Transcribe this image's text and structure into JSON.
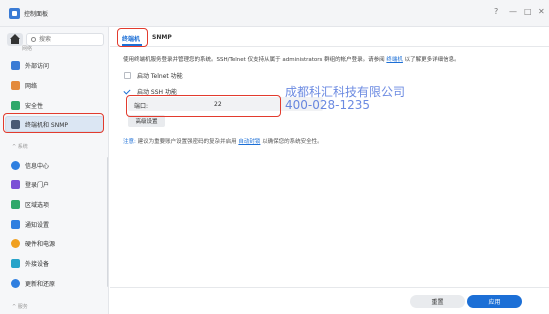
{
  "window": {
    "title": "控制面板",
    "controls": {
      "help": "?",
      "minimize": "—",
      "maximize": "□",
      "close": "✕"
    }
  },
  "sidebar": {
    "search_placeholder": "搜索",
    "top_cut_label": "网络",
    "items_top": [
      {
        "label": "外部访问",
        "icon": "external-access-icon",
        "color": "#3a7bd5"
      },
      {
        "label": "网络",
        "icon": "network-icon",
        "color": "#e38a3c"
      },
      {
        "label": "安全性",
        "icon": "security-shield-icon",
        "color": "#2fa86a"
      },
      {
        "label": "终端机和 SNMP",
        "icon": "terminal-icon",
        "color": "#4a5a73"
      }
    ],
    "section_system": "系统",
    "items_system": [
      {
        "label": "信息中心",
        "icon": "info-center-icon",
        "color": "#2f7fe0"
      },
      {
        "label": "登录门户",
        "icon": "login-portal-icon",
        "color": "#7b4fd6"
      },
      {
        "label": "区域选项",
        "icon": "regional-options-icon",
        "color": "#2fa86a"
      },
      {
        "label": "通知设置",
        "icon": "notification-icon",
        "color": "#2f7fe0"
      },
      {
        "label": "硬件和电源",
        "icon": "hardware-power-icon",
        "color": "#f0a020"
      },
      {
        "label": "外接设备",
        "icon": "external-devices-icon",
        "color": "#26a3c9"
      },
      {
        "label": "更新和还原",
        "icon": "update-restore-icon",
        "color": "#2f7fe0"
      }
    ],
    "section_bottom": "服务"
  },
  "tabs": [
    {
      "label": "终端机",
      "active": true
    },
    {
      "label": "SNMP",
      "active": false
    }
  ],
  "terminal": {
    "description_prefix": "使用终端机服务登录并管理您的系统。SSH/Telnet 仅支持从属于 administrators 群组的帐户登录。请参阅",
    "description_link": "终端机",
    "description_suffix": "以了解更多详细信息。",
    "telnet_label": "启动 Telnet 功能",
    "telnet_checked": false,
    "ssh_label": "启动 SSH 功能",
    "ssh_checked": true,
    "port_label": "端口:",
    "port_value": "22",
    "advanced_button": "高级设置",
    "note_label": "注意:",
    "note_prefix": "建议为重要账户设置强密码的复杂并启用",
    "note_link": "自动封锁",
    "note_suffix": "以确保您的系统安全性。"
  },
  "watermark": {
    "line1": "成都科汇科技有限公司",
    "line2": "400-028-1235"
  },
  "footer": {
    "reset_label": "重置",
    "apply_label": "应用"
  },
  "colors": {
    "accent": "#1c6fd6",
    "highlight_box": "#e23b2e",
    "watermark": "#3a63d8"
  }
}
